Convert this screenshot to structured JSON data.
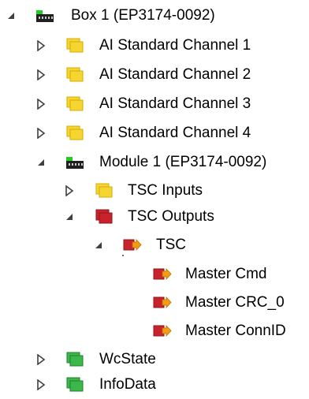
{
  "tree": {
    "nodes": [
      {
        "label": "Box 1 (EP3174-0092)",
        "toggle": "expanded",
        "icon": "box-module-icon"
      },
      {
        "label": "AI Standard Channel 1",
        "toggle": "collapsed",
        "icon": "yellow-input-folder-icon"
      },
      {
        "label": "AI Standard Channel 2",
        "toggle": "collapsed",
        "icon": "yellow-input-folder-icon"
      },
      {
        "label": "AI Standard Channel 3",
        "toggle": "collapsed",
        "icon": "yellow-input-folder-icon"
      },
      {
        "label": "AI Standard Channel 4",
        "toggle": "collapsed",
        "icon": "yellow-input-folder-icon"
      },
      {
        "label": "Module 1 (EP3174-0092)",
        "toggle": "expanded",
        "icon": "box-module-icon"
      },
      {
        "label": "TSC Inputs",
        "toggle": "collapsed",
        "icon": "yellow-input-folder-icon"
      },
      {
        "label": "TSC Outputs",
        "toggle": "expanded",
        "icon": "red-output-folder-icon"
      },
      {
        "label": "TSC",
        "toggle": "expanded",
        "icon": "red-output-variable-icon"
      },
      {
        "label": "Master Cmd",
        "toggle": "none",
        "icon": "red-output-variable-icon"
      },
      {
        "label": "Master CRC_0",
        "toggle": "none",
        "icon": "red-output-variable-icon"
      },
      {
        "label": "Master ConnID",
        "toggle": "none",
        "icon": "red-output-variable-icon"
      },
      {
        "label": "WcState",
        "toggle": "collapsed",
        "icon": "green-status-folder-icon"
      },
      {
        "label": "InfoData",
        "toggle": "collapsed",
        "icon": "green-status-folder-icon"
      }
    ]
  },
  "colors": {
    "yellow": "#f5d530",
    "yellow_dark": "#d4aa00",
    "red": "#c8232c",
    "red_dark": "#8e141a",
    "green": "#3cb84a",
    "green_dark": "#1f7f2a",
    "module_dark": "#202020",
    "module_green": "#22cc22",
    "arrow_orange": "#f39c12",
    "toggle": "#404040"
  }
}
